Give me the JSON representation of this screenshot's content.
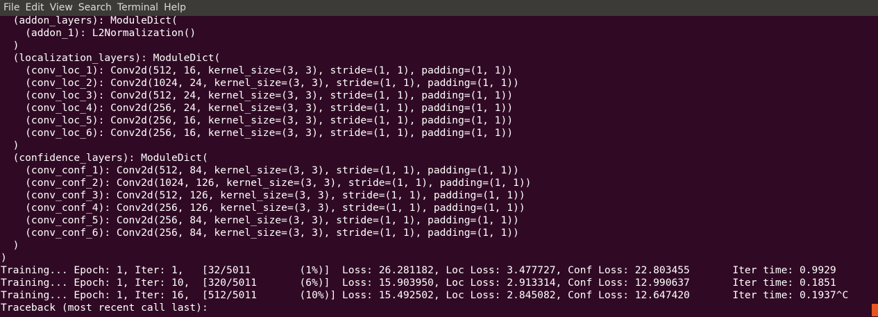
{
  "menubar": {
    "items": [
      {
        "label": "File"
      },
      {
        "label": "Edit"
      },
      {
        "label": "View"
      },
      {
        "label": "Search"
      },
      {
        "label": "Terminal"
      },
      {
        "label": "Help"
      }
    ]
  },
  "terminal": {
    "lines": [
      "  (addon_layers): ModuleDict(",
      "    (addon_1): L2Normalization()",
      "  )",
      "  (localization_layers): ModuleDict(",
      "    (conv_loc_1): Conv2d(512, 16, kernel_size=(3, 3), stride=(1, 1), padding=(1, 1))",
      "    (conv_loc_2): Conv2d(1024, 24, kernel_size=(3, 3), stride=(1, 1), padding=(1, 1))",
      "    (conv_loc_3): Conv2d(512, 24, kernel_size=(3, 3), stride=(1, 1), padding=(1, 1))",
      "    (conv_loc_4): Conv2d(256, 24, kernel_size=(3, 3), stride=(1, 1), padding=(1, 1))",
      "    (conv_loc_5): Conv2d(256, 16, kernel_size=(3, 3), stride=(1, 1), padding=(1, 1))",
      "    (conv_loc_6): Conv2d(256, 16, kernel_size=(3, 3), stride=(1, 1), padding=(1, 1))",
      "  )",
      "  (confidence_layers): ModuleDict(",
      "    (conv_conf_1): Conv2d(512, 84, kernel_size=(3, 3), stride=(1, 1), padding=(1, 1))",
      "    (conv_conf_2): Conv2d(1024, 126, kernel_size=(3, 3), stride=(1, 1), padding=(1, 1))",
      "    (conv_conf_3): Conv2d(512, 126, kernel_size=(3, 3), stride=(1, 1), padding=(1, 1))",
      "    (conv_conf_4): Conv2d(256, 126, kernel_size=(3, 3), stride=(1, 1), padding=(1, 1))",
      "    (conv_conf_5): Conv2d(256, 84, kernel_size=(3, 3), stride=(1, 1), padding=(1, 1))",
      "    (conv_conf_6): Conv2d(256, 84, kernel_size=(3, 3), stride=(1, 1), padding=(1, 1))",
      "  )",
      ")",
      "Training... Epoch: 1, Iter: 1,   [32/5011        (1%)]  Loss: 26.281182, Loc Loss: 3.477727, Conf Loss: 22.803455       Iter time: 0.9929",
      "Training... Epoch: 1, Iter: 10,  [320/5011       (6%)]  Loss: 15.903950, Loc Loss: 2.913314, Conf Loss: 12.990637       Iter time: 0.1851",
      "Training... Epoch: 1, Iter: 16,  [512/5011       (10%)] Loss: 15.492502, Loc Loss: 2.845082, Conf Loss: 12.647420       Iter time: 0.1937^C",
      "Traceback (most recent call last):"
    ]
  },
  "colors": {
    "background": "#300a24",
    "menubar": "#3c3b37",
    "text": "#ffffff",
    "cursor": "#e95420"
  }
}
